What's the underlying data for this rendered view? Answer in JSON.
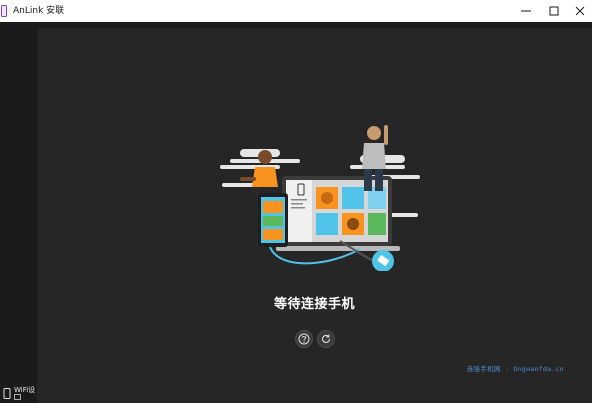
{
  "window": {
    "title": "AnLink 安联",
    "controls": [
      "minimize",
      "maximize",
      "close"
    ]
  },
  "main": {
    "status_text": "等待连接手机",
    "help_icon": "question-circle-icon",
    "refresh_icon": "refresh-icon"
  },
  "sidebar": {
    "wifi_label": "WiFi设",
    "wifi_icon": "phone-wifi-icon"
  },
  "watermark": "连接手机网 · Ongwanfda.cn",
  "colors": {
    "titlebar_bg": "#ffffff",
    "app_bg": "#1b1b1b",
    "panel_bg": "#262626",
    "accent_blue": "#4e8fd6",
    "illustration_orange": "#f7931e",
    "illustration_cyan": "#4fc3e8"
  }
}
